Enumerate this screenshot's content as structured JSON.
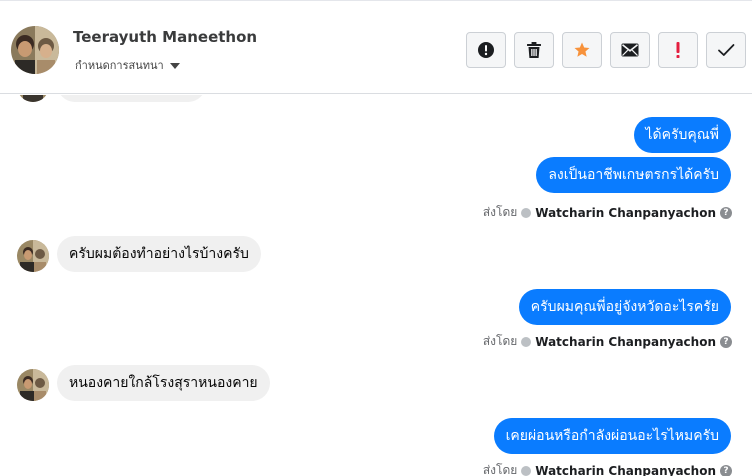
{
  "conversation": {
    "contact_name": "Teerayuth Maneethon",
    "assign_label": "กำหนดการสนทนา",
    "actions": [
      {
        "icon": "alert-circle-icon",
        "color": "#1c1e21"
      },
      {
        "icon": "trash-icon",
        "color": "#1c1e21"
      },
      {
        "icon": "star-icon",
        "color": "#f7923b"
      },
      {
        "icon": "envelope-icon",
        "color": "#1c1e21"
      },
      {
        "icon": "exclamation-icon",
        "color": "#e41e3f"
      },
      {
        "icon": "checkmark-icon",
        "color": "#1c1e21"
      }
    ]
  },
  "messages": {
    "out_1": "ได้ครับคุณพี่",
    "out_2": "ลงเป็นอาชีพเกษตรกรได้ครับ",
    "in_1": "ครับผมต้องทำอย่างไรบ้างครับ",
    "out_3": "ครับผมคุณพี่อยู่จังหวัดอะไรครัย",
    "in_2": "หนองคายใกล้โรงสุราหนองคาย",
    "out_4": "เคยผ่อนหรือกำลังผ่อนอะไรไหมครับ"
  },
  "sent_by": {
    "prefix": "ส่งโดย",
    "name": "Watcharin Chanpanyachon",
    "help": "?"
  },
  "colors": {
    "outgoing_bubble": "#0a7cff",
    "incoming_bubble": "#f0f0f0"
  }
}
